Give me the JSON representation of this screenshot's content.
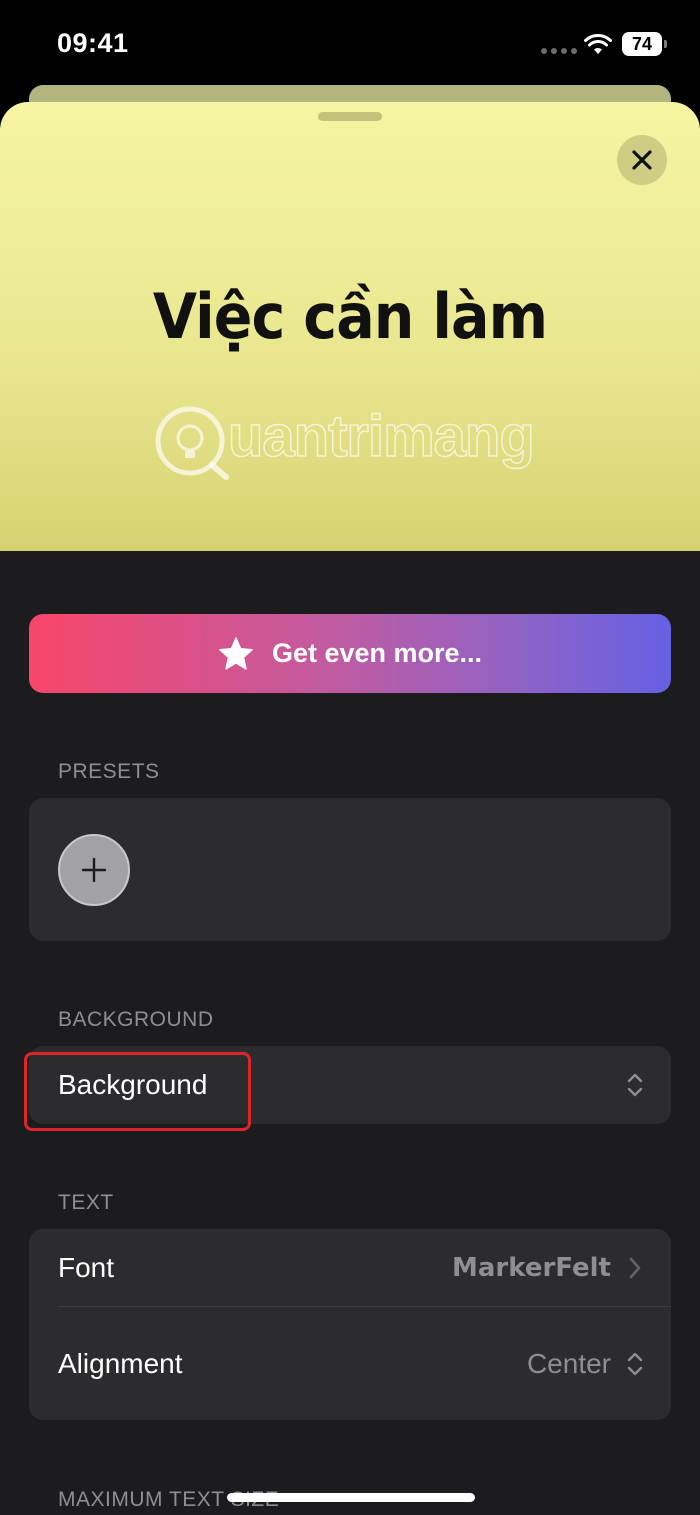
{
  "status_bar": {
    "time": "09:41",
    "battery": "74"
  },
  "preview": {
    "title": "Việc cần làm",
    "watermark": "uantrimang"
  },
  "promo": {
    "label": "Get even more..."
  },
  "sections": {
    "presets": "PRESETS",
    "background": "BACKGROUND",
    "text": "TEXT",
    "max_text_size": "MAXIMUM TEXT SIZE"
  },
  "background_row": {
    "label": "Background"
  },
  "text_rows": [
    {
      "label": "Font",
      "value": "MarkerFelt"
    },
    {
      "label": "Alignment",
      "value": "Center"
    }
  ],
  "colors": {
    "accent_gradient": [
      "#f8466a",
      "#6660e4"
    ],
    "highlight": "#e0242b",
    "preview_bg": "#f5f5a2"
  },
  "icons": [
    "wifi-icon",
    "close-icon",
    "star-icon",
    "plus-icon",
    "chevron-up-down-icon",
    "chevron-right-icon"
  ]
}
